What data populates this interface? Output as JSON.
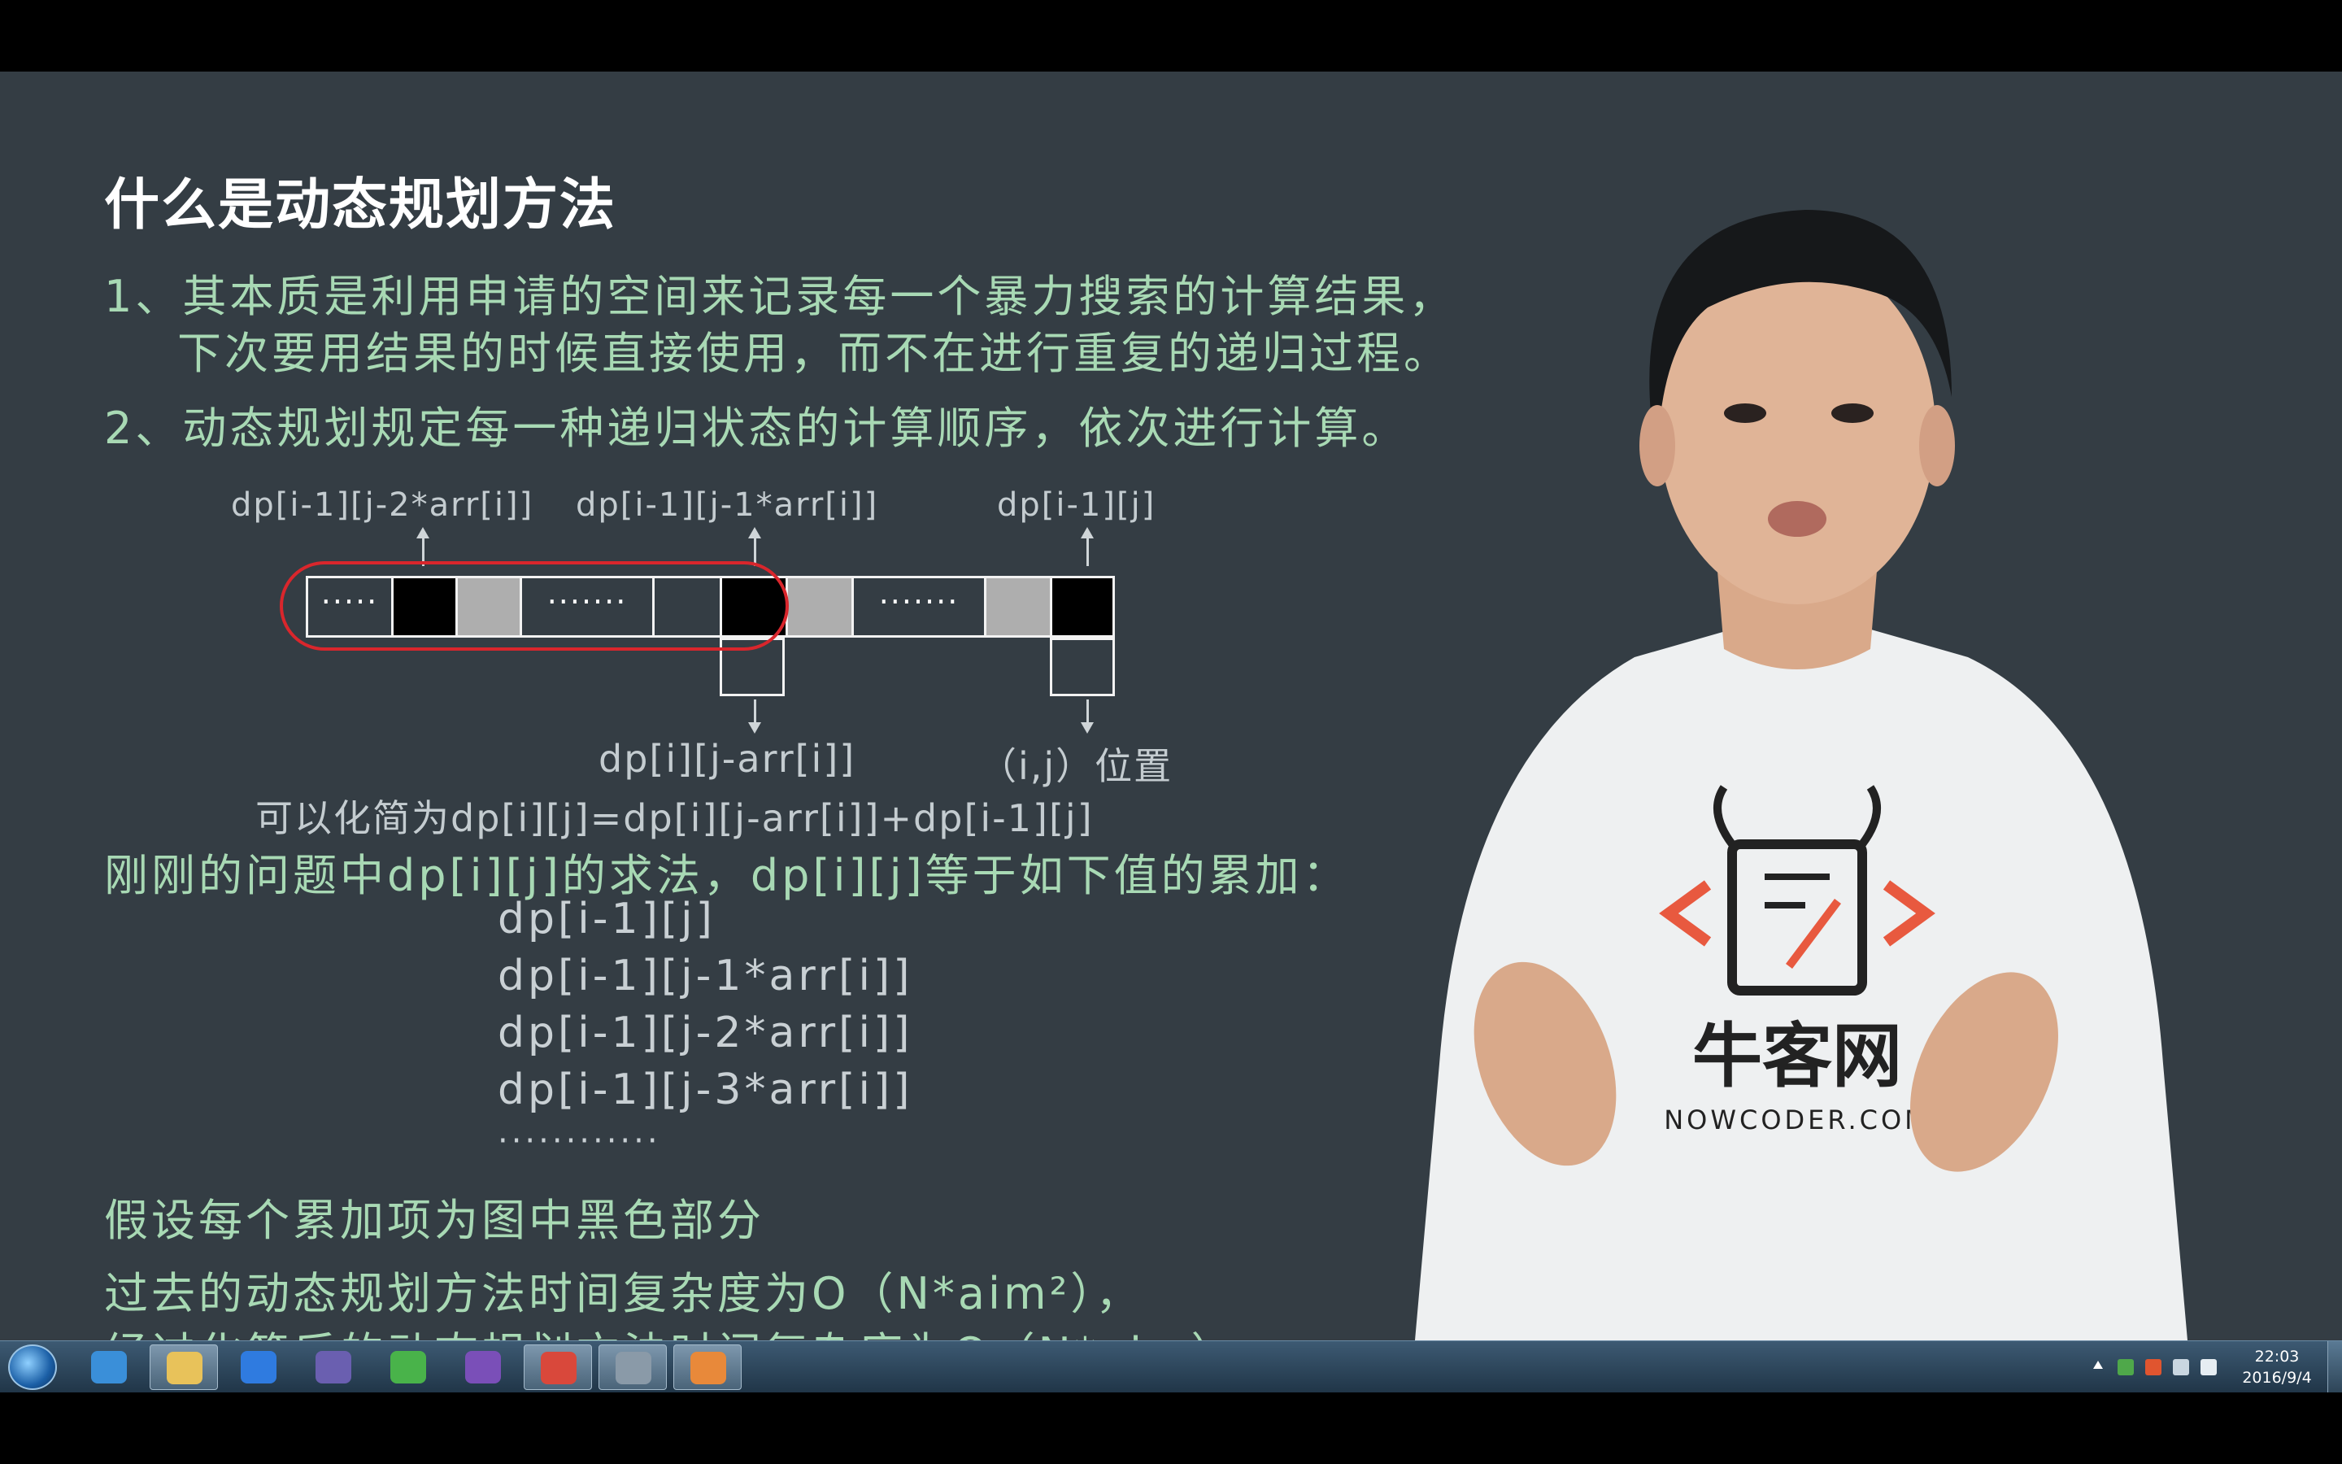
{
  "slide": {
    "title": "什么是动态规划方法",
    "point1_line1": "1、其本质是利用申请的空间来记录每一个暴力搜索的计算结果，",
    "point1_line2": "下次要用结果的时候直接使用，而不在进行重复的递归过程。",
    "point2": "2、动态规划规定每一种递归状态的计算顺序，依次进行计算。",
    "diagram": {
      "label_j2": "dp[i-1][j-2*arr[i]]",
      "label_j1": "dp[i-1][j-1*arr[i]]",
      "label_j": "dp[i-1][j]",
      "label_below": "dp[i][j-arr[i]]",
      "label_pos": "（i,j）位置",
      "dots_short": "·····",
      "dots_long": "·······"
    },
    "simplify": "可以化简为dp[i][j]=dp[i][j-arr[i]]+dp[i-1][j]",
    "problem_line": "刚刚的问题中dp[i][j]的求法，dp[i][j]等于如下值的累加：",
    "terms": [
      "dp[i-1][j]",
      "dp[i-1][j-1*arr[i]]",
      "dp[i-1][j-2*arr[i]]",
      "dp[i-1][j-3*arr[i]]",
      "············"
    ],
    "assume": "假设每个累加项为图中黑色部分",
    "complexity_before": "过去的动态规划方法时间复杂度为O（N*aim²），",
    "complexity_after": "经过化简后的动态规划方法时间复杂度为O（N*aim）"
  },
  "presenter": {
    "logo_text": "牛客网",
    "logo_sub": "NOWCODER.COM"
  },
  "taskbar": {
    "apps": [
      {
        "name": "ie-icon",
        "color": "#3a8fd9"
      },
      {
        "name": "explorer-icon",
        "color": "#e8c25a"
      },
      {
        "name": "baidu-icon",
        "color": "#2f7be0"
      },
      {
        "name": "bowtie-app-icon",
        "color": "#6a5fb0"
      },
      {
        "name": "sync-icon",
        "color": "#49b34a"
      },
      {
        "name": "visual-studio-icon",
        "color": "#7a4fb8"
      },
      {
        "name": "chrome-icon",
        "color": "#d9483b"
      },
      {
        "name": "video-editor-icon",
        "color": "#8a9aa8"
      },
      {
        "name": "player-icon",
        "color": "#e8893a"
      }
    ],
    "clock_time": "22:03",
    "clock_date": "2016/9/4"
  }
}
